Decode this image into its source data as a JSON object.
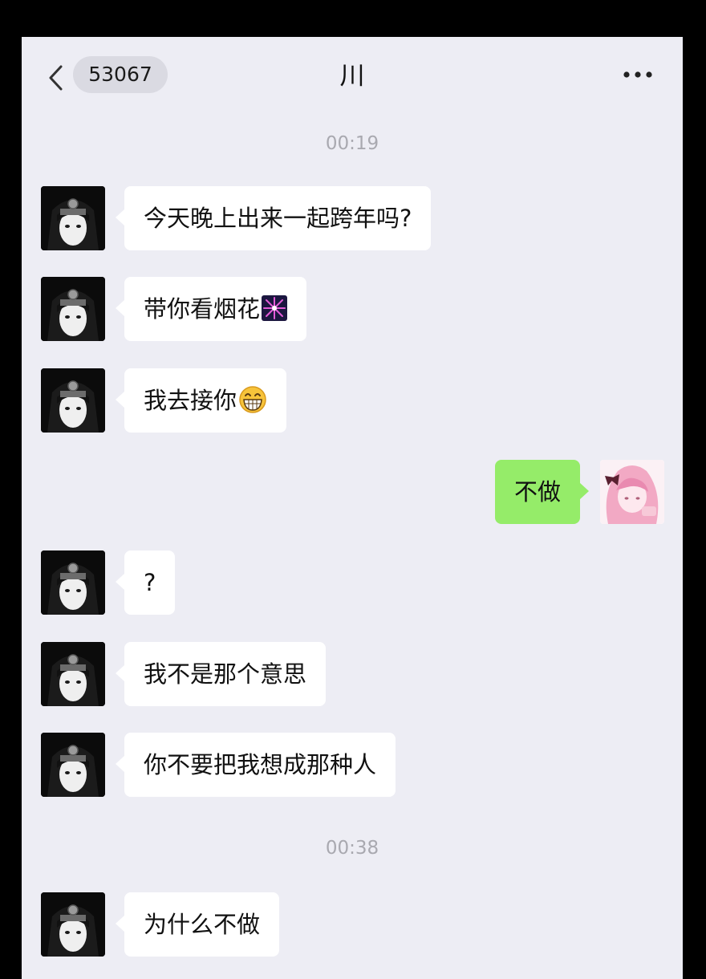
{
  "header": {
    "unread_count": "53067",
    "title": "川"
  },
  "timestamps": [
    "00:19",
    "00:38"
  ],
  "messages": [
    {
      "side": "in",
      "text": "今天晚上出来一起跨年吗?",
      "emoji": ""
    },
    {
      "side": "in",
      "text": "带你看烟花",
      "emoji": "fireworks-emoji"
    },
    {
      "side": "in",
      "text": "我去接你",
      "emoji": "grinning-face-emoji"
    },
    {
      "side": "out",
      "text": "不做",
      "emoji": ""
    },
    {
      "side": "in",
      "text": "?",
      "emoji": ""
    },
    {
      "side": "in",
      "text": "我不是那个意思",
      "emoji": ""
    },
    {
      "side": "in",
      "text": "你不要把我想成那种人",
      "emoji": ""
    },
    {
      "side": "in",
      "text": "为什么不做",
      "emoji": ""
    }
  ],
  "colors": {
    "background": "#EDEDF4",
    "incoming_bubble": "#FFFFFF",
    "outgoing_bubble": "#95EC69",
    "timestamp_text": "#A9A9B0"
  }
}
